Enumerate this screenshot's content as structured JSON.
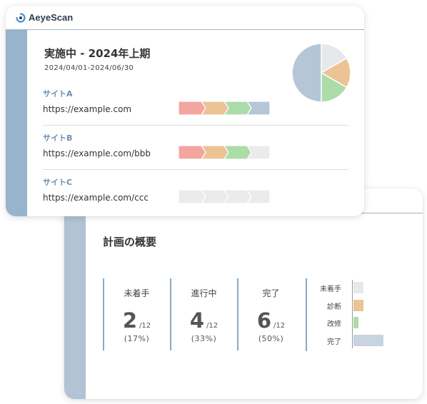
{
  "brand": {
    "name": "AeyeScan"
  },
  "project": {
    "title": "実施中 - 2024年上期",
    "period": "2024/04/01-2024/06/30"
  },
  "sites": [
    {
      "name": "サイトA",
      "url": "https://example.com",
      "completed_steps": 4
    },
    {
      "name": "サイトB",
      "url": "https://example.com/bbb",
      "completed_steps": 3
    },
    {
      "name": "サイトC",
      "url": "https://example.com/ccc",
      "completed_steps": 0
    }
  ],
  "step_colors": [
    "#f3a59f",
    "#ecc395",
    "#acdca8",
    "#b5c7d6"
  ],
  "step_empty_color": "#ebebeb",
  "pie": {
    "slices": [
      {
        "label": "未着手",
        "value": 2,
        "color": "#e6e8ec"
      },
      {
        "label": "診断",
        "value": 2,
        "color": "#ecc395"
      },
      {
        "label": "改修",
        "value": 2,
        "color": "#acdca8"
      },
      {
        "label": "完了",
        "value": 6,
        "color": "#b5c7d6"
      }
    ]
  },
  "plan": {
    "title": "計画の概要",
    "stats": [
      {
        "label": "未着手",
        "value": "2",
        "total": "/12",
        "pct": "(17%)"
      },
      {
        "label": "進行中",
        "value": "4",
        "total": "/12",
        "pct": "(33%)"
      },
      {
        "label": "完了",
        "value": "6",
        "total": "/12",
        "pct": "(50%)"
      }
    ]
  },
  "chart_data": {
    "type": "bar",
    "orientation": "horizontal",
    "categories": [
      "未着手",
      "診断",
      "改修",
      "完了"
    ],
    "values": [
      2,
      2,
      1,
      6
    ],
    "colors": [
      "#e6e8ec",
      "#ecc395",
      "#acdca8",
      "#c8d4df"
    ],
    "xlim": [
      0,
      12
    ],
    "grid": false
  }
}
